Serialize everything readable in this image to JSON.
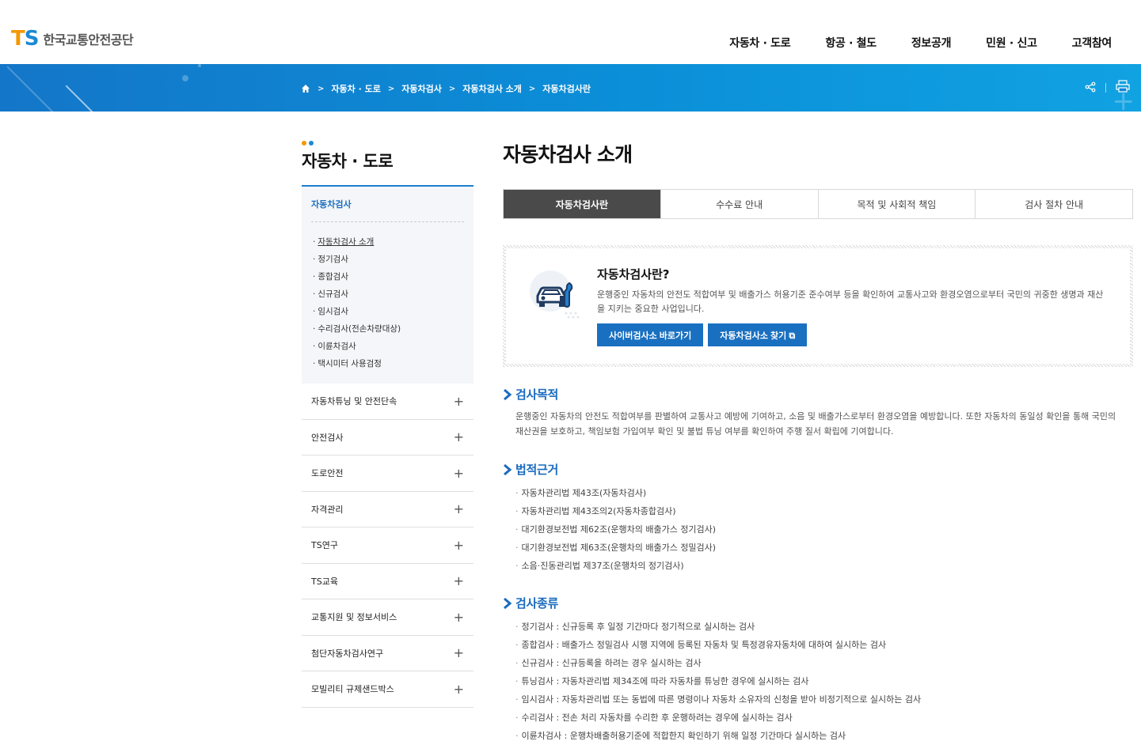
{
  "header": {
    "logo_mark_t": "T",
    "logo_mark_s": "S",
    "logo_text": "한국교통안전공단",
    "nav": [
      "자동차 · 도로",
      "항공 · 철도",
      "정보공개",
      "민원 · 신고",
      "고객참여"
    ]
  },
  "breadcrumb": [
    "자동차 · 도로",
    "자동차검사",
    "자동차검사 소개",
    "자동차검사란"
  ],
  "sidebar": {
    "title": "자동차 · 도로",
    "current": "자동차검사",
    "sub_items": [
      "자동차검사 소개",
      "정기검사",
      "종합검사",
      "신규검사",
      "임시검사",
      "수리검사(전손차량대상)",
      "이륜차검사",
      "택시미터 사용검정"
    ],
    "menu": [
      "자동차튜닝 및 안전단속",
      "안전검사",
      "도로안전",
      "자격관리",
      "TS연구",
      "TS교육",
      "교통지원 및 정보서비스",
      "첨단자동차검사연구",
      "모빌리티 규제샌드박스"
    ]
  },
  "main": {
    "title": "자동차검사 소개",
    "tabs": [
      "자동차검사란",
      "수수료 안내",
      "목적 및 사회적 책임",
      "검사 절차 안내"
    ],
    "intro": {
      "title": "자동차검사란?",
      "desc": "운행중인 자동차의 안전도 적합여부 및 배출가스 허용기준 준수여부 등을 확인하여 교통사고와 환경오염으로부터 국민의 귀중한 생명과 재산을 지키는 중요한 사업입니다.",
      "btn1": "사이버검사소 바로가기",
      "btn2": "자동차검사소 찾기 ⧉"
    },
    "sections": {
      "purpose": {
        "title": "검사목적",
        "text": "운행중인 자동차의 안전도 적합여부를 판별하여 교통사고 예방에 기여하고, 소음 및 배출가스로부터 환경오염을 예방합니다. 또한 자동차의 동일성 확인을 통해 국민의 재산권을 보호하고, 책임보험 가입여부 확인 및 불법 튜닝 여부를 확인하여 주행 질서 확립에 기여합니다."
      },
      "legal": {
        "title": "법적근거",
        "items": [
          "자동차관리법 제43조(자동차검사)",
          "자동차관리법 제43조의2(자동차종합검사)",
          "대기환경보전법 제62조(운행차의 배출가스 정기검사)",
          "대기환경보전법 제63조(운행차의 배출가스 정밀검사)",
          "소음·진동관리법 제37조(운행차의 정기검사)"
        ]
      },
      "types": {
        "title": "검사종류",
        "items": [
          "정기검사 : 신규등록 후 일정 기간마다 정기적으로 실시하는 검사",
          "종합검사 : 배출가스 정밀검사 시행 지역에 등록된 자동차 및 특정경유자동차에 대하여 실시하는 검사",
          "신규검사 : 신규등록을 하려는 경우 실시하는 검사",
          "튜닝검사 : 자동차관리법 제34조에 따라 자동차를 튜닝한 경우에 실시하는 검사",
          "임시검사 : 자동차관리법 또는 동법에 따른 명령이나 자동차 소유자의 신청을 받아 비정기적으로 실시하는 검사",
          "수리검사 : 전손 처리 자동차를 수리한 후 운행하려는 경우에 실시하는 검사",
          "이륜차검사 : 운행차배출허용기준에 적합한지 확인하기 위해 일정 기간마다 실시하는 검사"
        ]
      }
    }
  },
  "colors": {
    "brand_orange": "#f39800",
    "brand_blue": "#1b8ad3",
    "accent": "#1a70c0"
  }
}
